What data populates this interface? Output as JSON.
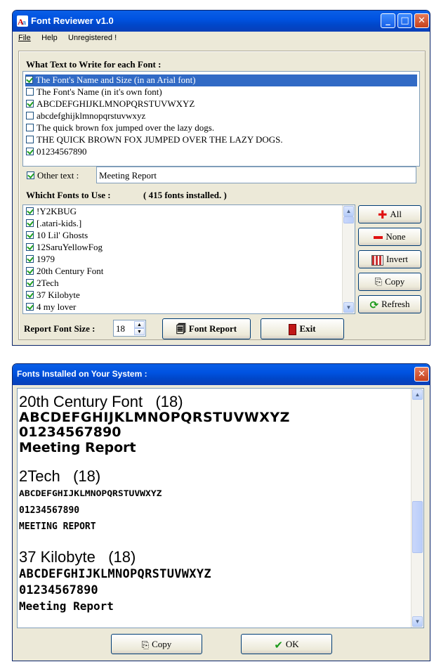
{
  "main_window": {
    "title": "Font Reviewer v1.0",
    "menu": [
      "File",
      "Help",
      "Unregistered !"
    ],
    "what_text_label": "What Text to Write for each Font :",
    "text_options": [
      {
        "label": "The Font's Name and Size (in an Arial font)",
        "checked": true,
        "selected": true
      },
      {
        "label": "The Font's Name (in it's own font)",
        "checked": false,
        "selected": false
      },
      {
        "label": "ABCDEFGHIJKLMNOPQRSTUVWXYZ",
        "checked": true,
        "selected": false
      },
      {
        "label": "abcdefghijklmnopqrstuvwxyz",
        "checked": false,
        "selected": false
      },
      {
        "label": "The quick brown fox jumped over the lazy dogs.",
        "checked": false,
        "selected": false
      },
      {
        "label": "THE QUICK BROWN FOX JUMPED OVER THE LAZY DOGS.",
        "checked": false,
        "selected": false
      },
      {
        "label": "01234567890",
        "checked": true,
        "selected": false
      }
    ],
    "other_text_label": "Other text :",
    "other_text_checked": true,
    "other_text_value": "Meeting Report",
    "fonts_label": "Whicht Fonts to Use :",
    "fonts_count": "( 415 fonts installed. )",
    "fonts": [
      "!Y2KBUG",
      "[.atari-kids.]",
      "10 Lil' Ghosts",
      "12SaruYellowFog",
      "1979",
      "20th Century Font",
      "2Tech",
      "37 Kilobyte",
      "4 my lover"
    ],
    "side_buttons": {
      "all": "All",
      "none": "None",
      "invert": "Invert",
      "copy": "Copy",
      "refresh": "Refresh"
    },
    "report_font_size_label": "Report Font Size :",
    "report_font_size_value": "18",
    "font_report_button": "Font Report",
    "exit_button": "Exit"
  },
  "report_window": {
    "title": "Fonts Installed on Your System :",
    "entries": [
      {
        "name": "20th Century Font",
        "size": "(18)",
        "lines": [
          "ABCDEFGHIJKLMNOPQRSTUVWXYZ",
          "01234567890",
          "Meeting Report"
        ]
      },
      {
        "name": "2Tech",
        "size": "(18)",
        "lines": [
          "ABCDEFGHIJKLMNOPQRSTUVWXYZ",
          "01234567890",
          "MEETING REPORT"
        ]
      },
      {
        "name": "37 Kilobyte",
        "size": "(18)",
        "lines": [
          "ABCDEFGHIJKLMNOPQRSTUVWXYZ",
          "01234567890",
          "Meeting Report"
        ]
      }
    ],
    "copy_button": "Copy",
    "ok_button": "OK"
  },
  "colors": {
    "titlebar": "#0053e1",
    "selection": "#316ac5",
    "check": "#21a121",
    "window_bg": "#ece9d8"
  }
}
